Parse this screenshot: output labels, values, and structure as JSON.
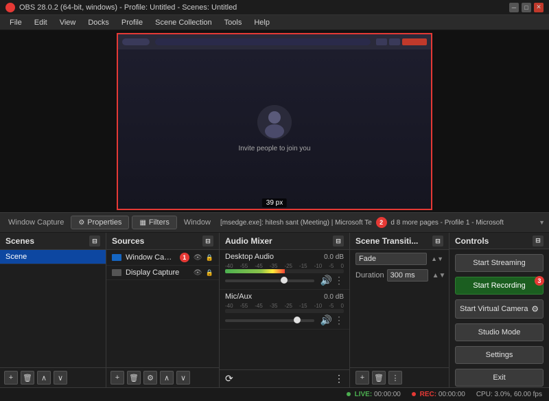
{
  "titlebar": {
    "title": "OBS 28.0.2 (64-bit, windows) - Profile: Untitled - Scenes: Untitled",
    "icon": "●"
  },
  "menubar": {
    "items": [
      "File",
      "Edit",
      "View",
      "Docks",
      "Profile",
      "Scene Collection",
      "Tools",
      "Help"
    ]
  },
  "preview": {
    "size_label": "39 px",
    "invite_text": "Invite people to join you"
  },
  "source_controls": {
    "properties_label": "Properties",
    "filters_label": "Filters",
    "window_label": "Window",
    "window_info": "[msedge.exe]: hitesh sant (Meeting) | Microsoft Te",
    "more_label": "d 8 more pages - Profile 1 - Microsoft",
    "badge": "2"
  },
  "scenes_panel": {
    "title": "Scenes",
    "items": [
      {
        "name": "Scene",
        "active": true
      }
    ],
    "toolbar": [
      "+",
      "🗑",
      "∧",
      "∨"
    ]
  },
  "sources_panel": {
    "title": "Sources",
    "items": [
      {
        "name": "Window Captu...",
        "type": "window",
        "badge": "1",
        "has_badge": true
      },
      {
        "name": "Display Capture",
        "type": "monitor",
        "has_badge": false
      }
    ],
    "toolbar": [
      "+",
      "🗑",
      "⚙",
      "∧",
      "∨"
    ]
  },
  "audio_panel": {
    "title": "Audio Mixer",
    "channels": [
      {
        "name": "Desktop Audio",
        "db": "0.0 dB",
        "labels": [
          "-40",
          "-55",
          "-45",
          "-35",
          "-25",
          "-15",
          "-10",
          "-5",
          "0"
        ],
        "fill_pct": 50,
        "vol_pct": 70
      },
      {
        "name": "Mic/Aux",
        "db": "0.0 dB",
        "labels": [
          "-40",
          "-55",
          "-45",
          "-35",
          "-25",
          "-15",
          "-10",
          "-5",
          "0"
        ],
        "fill_pct": 0,
        "vol_pct": 85
      }
    ]
  },
  "transitions_panel": {
    "title": "Scene Transiti...",
    "fade_label": "Fade",
    "duration_label": "Duration",
    "duration_value": "300 ms",
    "toolbar": [
      "+",
      "🗑",
      "⋮"
    ]
  },
  "controls_panel": {
    "title": "Controls",
    "buttons": [
      {
        "label": "Start Streaming",
        "type": "normal",
        "key": "start-streaming"
      },
      {
        "label": "Start Recording",
        "type": "recording",
        "key": "start-recording"
      },
      {
        "label": "Start Virtual Camera",
        "type": "normal",
        "key": "start-virtual"
      },
      {
        "label": "Studio Mode",
        "type": "normal",
        "key": "studio-mode"
      },
      {
        "label": "Settings",
        "type": "normal",
        "key": "settings"
      },
      {
        "label": "Exit",
        "type": "normal",
        "key": "exit"
      }
    ]
  },
  "statusbar": {
    "live_label": "LIVE:",
    "live_time": "00:00:00",
    "rec_label": "REC:",
    "rec_time": "00:00:00",
    "cpu_label": "CPU: 3.0%, 60.00 fps"
  }
}
